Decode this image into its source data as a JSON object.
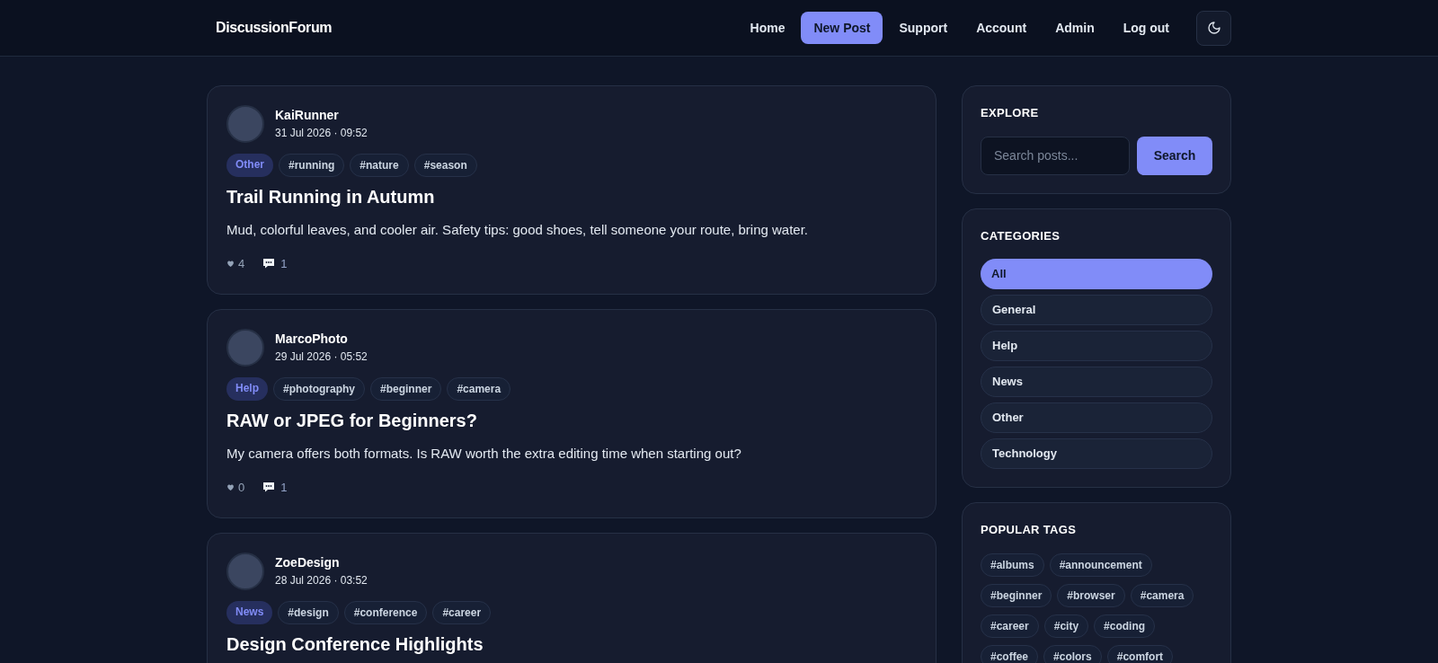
{
  "brand": "DiscussionForum",
  "nav": [
    {
      "label": "Home",
      "selected": false
    },
    {
      "label": "New Post",
      "selected": true
    },
    {
      "label": "Support",
      "selected": false
    },
    {
      "label": "Account",
      "selected": false
    },
    {
      "label": "Admin",
      "selected": false
    },
    {
      "label": "Log out",
      "selected": false
    }
  ],
  "posts": [
    {
      "author": "KaiRunner",
      "date": "31 Jul 2026 · 09:52",
      "category": "Other",
      "tags": [
        "#running",
        "#nature",
        "#season"
      ],
      "title": "Trail Running in Autumn",
      "body": "Mud, colorful leaves, and cooler air. Safety tips: good shoes, tell someone your route, bring water.",
      "likes": "4",
      "comments": "1"
    },
    {
      "author": "MarcoPhoto",
      "date": "29 Jul 2026 · 05:52",
      "category": "Help",
      "tags": [
        "#photography",
        "#beginner",
        "#camera"
      ],
      "title": "RAW or JPEG for Beginners?",
      "body": "My camera offers both formats. Is RAW worth the extra editing time when starting out?",
      "likes": "0",
      "comments": "1"
    },
    {
      "author": "ZoeDesign",
      "date": "28 Jul 2026 · 03:52",
      "category": "News",
      "tags": [
        "#design",
        "#conference",
        "#career"
      ],
      "title": "Design Conference Highlights"
    }
  ],
  "explore": {
    "title": "EXPLORE",
    "search": {
      "placeholder": "Search posts..."
    },
    "button": "Search"
  },
  "categories": {
    "title": "CATEGORIES",
    "items": [
      {
        "label": "All",
        "selected": true
      },
      {
        "label": "General",
        "selected": false
      },
      {
        "label": "Help",
        "selected": false
      },
      {
        "label": "News",
        "selected": false
      },
      {
        "label": "Other",
        "selected": false
      },
      {
        "label": "Technology",
        "selected": false
      }
    ]
  },
  "popular_tags": {
    "title": "POPULAR TAGS",
    "tags": [
      "#albums",
      "#announcement",
      "#beginner",
      "#browser",
      "#camera",
      "#career",
      "#city",
      "#coding",
      "#coffee",
      "#colors",
      "#comfort"
    ]
  }
}
